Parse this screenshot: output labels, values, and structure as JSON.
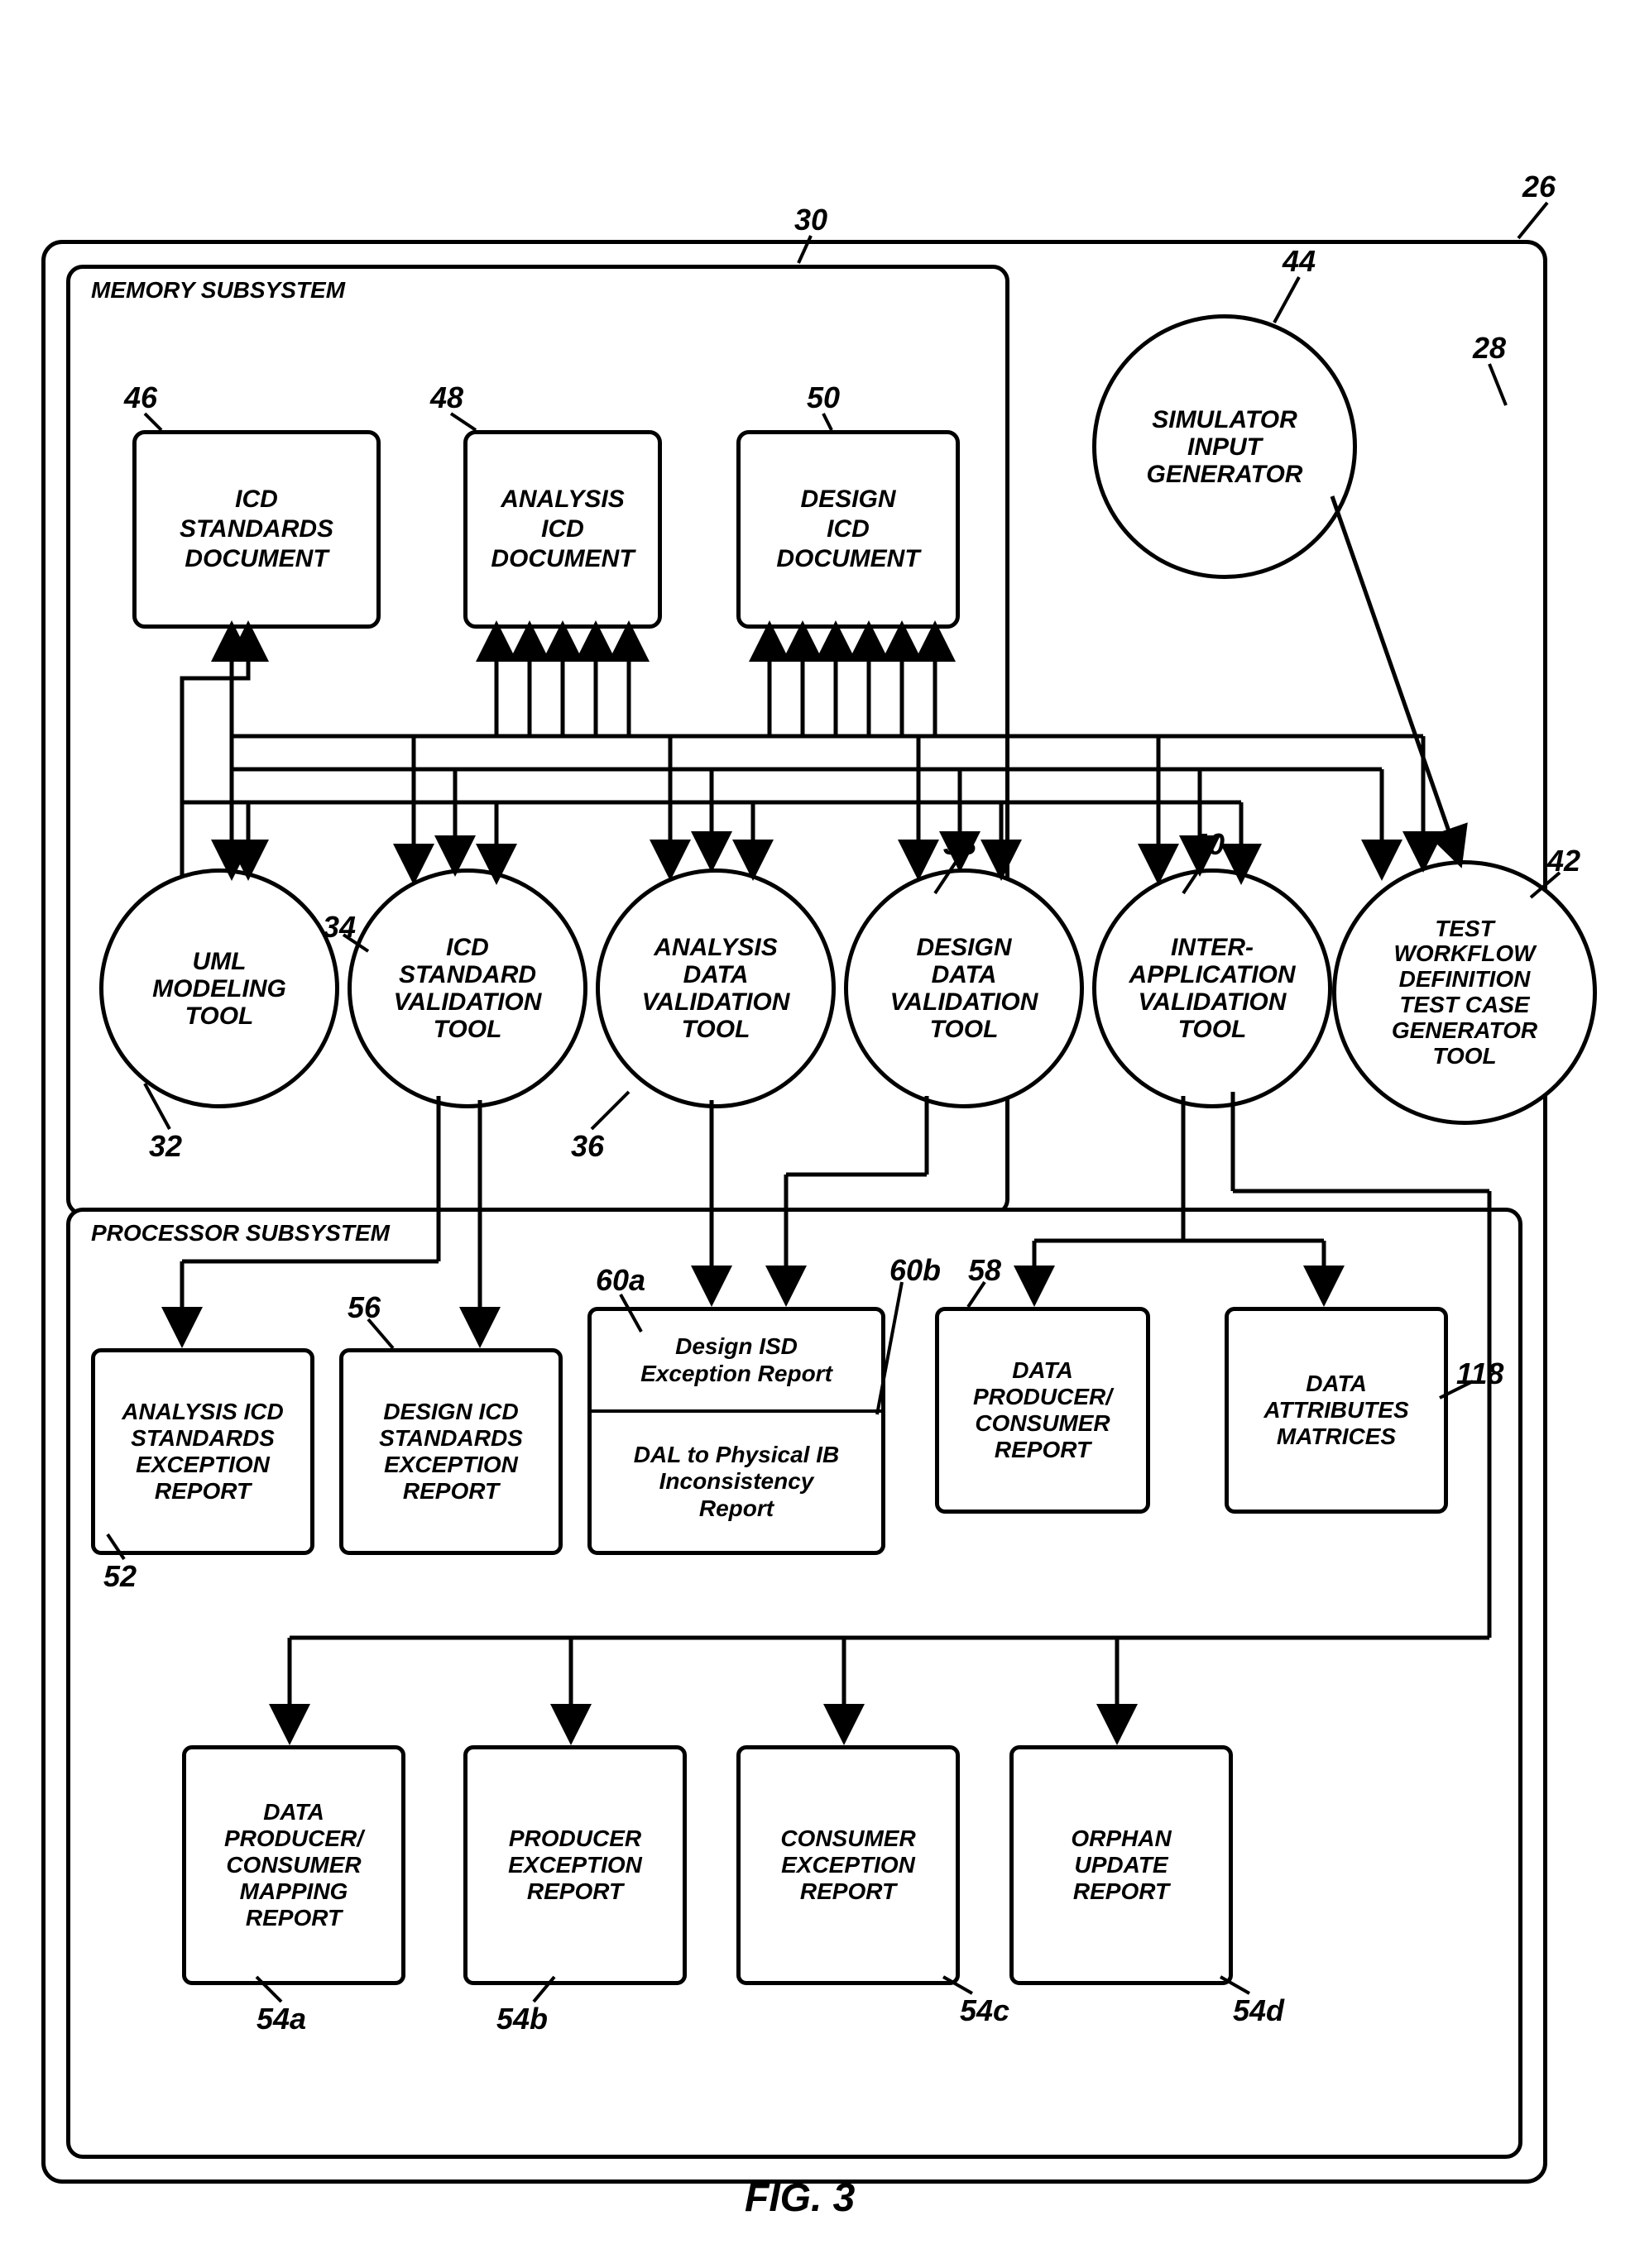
{
  "figure_label": "FIG. 3",
  "subsystems": {
    "memory": "MEMORY SUBSYSTEM",
    "processor": "PROCESSOR SUBSYSTEM"
  },
  "docs": {
    "icd_standards": "ICD\nSTANDARDS\nDOCUMENT",
    "analysis_icd": "ANALYSIS\nICD\nDOCUMENT",
    "design_icd": "DESIGN\nICD\nDOCUMENT"
  },
  "tools": {
    "sim_input": "SIMULATOR\nINPUT\nGENERATOR",
    "uml": "UML\nMODELING\nTOOL",
    "icd_std_val": "ICD\nSTANDARD\nVALIDATION\nTOOL",
    "analysis_val": "ANALYSIS\nDATA\nVALIDATION\nTOOL",
    "design_val": "DESIGN\nDATA\nVALIDATION\nTOOL",
    "interapp_val": "INTER-\nAPPLICATION\nVALIDATION\nTOOL",
    "test_gen": "TEST\nWORKFLOW\nDEFINITION\nTEST CASE\nGENERATOR\nTOOL"
  },
  "reports": {
    "analysis_icd_std": "ANALYSIS ICD\nSTANDARDS\nEXCEPTION\nREPORT",
    "design_icd_std": "DESIGN ICD\nSTANDARDS\nEXCEPTION\nREPORT",
    "design_isd_a": "Design ISD\nException Report",
    "design_isd_b": "DAL to Physical IB\nInconsistency\nReport",
    "data_prod_cons": "DATA\nPRODUCER/\nCONSUMER\nREPORT",
    "data_attr": "DATA\nATTRIBUTES\nMATRICES",
    "prod_cons_map": "DATA\nPRODUCER/\nCONSUMER\nMAPPING\nREPORT",
    "producer_exc": "PRODUCER\nEXCEPTION\nREPORT",
    "consumer_exc": "CONSUMER\nEXCEPTION\nREPORT",
    "orphan": "ORPHAN\nUPDATE\nREPORT"
  },
  "refs": {
    "r26": "26",
    "r28": "28",
    "r30": "30",
    "r32": "32",
    "r34": "34",
    "r36": "36",
    "r38": "38",
    "r40": "40",
    "r42": "42",
    "r44": "44",
    "r46": "46",
    "r48": "48",
    "r50": "50",
    "r52": "52",
    "r54a": "54a",
    "r54b": "54b",
    "r54c": "54c",
    "r54d": "54d",
    "r56": "56",
    "r58": "58",
    "r60a": "60a",
    "r60b": "60b",
    "r118": "118"
  }
}
